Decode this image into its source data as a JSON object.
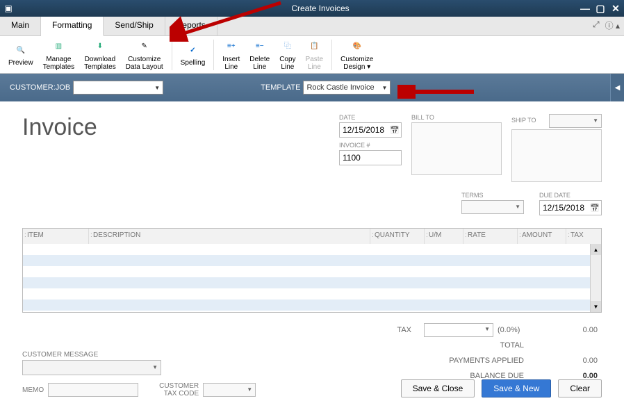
{
  "window": {
    "title": "Create Invoices"
  },
  "tabs": {
    "main": "Main",
    "formatting": "Formatting",
    "sendship": "Send/Ship",
    "reports": "Reports"
  },
  "ribbon": {
    "preview": "Preview",
    "manage_templates": "Manage\nTemplates",
    "download_templates": "Download\nTemplates",
    "customize_data_layout": "Customize\nData Layout",
    "spelling": "Spelling",
    "insert_line": "Insert\nLine",
    "delete_line": "Delete\nLine",
    "copy_line": "Copy\nLine",
    "paste_line": "Paste\nLine",
    "customize_design": "Customize\nDesign ▾"
  },
  "customer_bar": {
    "customer_job_label": "CUSTOMER:JOB",
    "customer_job_value": "",
    "template_label": "TEMPLATE",
    "template_value": "Rock Castle Invoice"
  },
  "invoice": {
    "title": "Invoice",
    "date_label": "DATE",
    "date_value": "12/15/2018",
    "invoice_num_label": "INVOICE #",
    "invoice_num_value": "1100",
    "bill_to_label": "BILL TO",
    "ship_to_label": "SHIP TO",
    "terms_label": "TERMS",
    "terms_value": "",
    "due_date_label": "DUE DATE",
    "due_date_value": "12/15/2018"
  },
  "columns": {
    "item": "ITEM",
    "description": "DESCRIPTION",
    "quantity": "QUANTITY",
    "um": "U/M",
    "rate": "RATE",
    "amount": "AMOUNT",
    "tax": "TAX"
  },
  "totals": {
    "tax_label": "TAX",
    "tax_pct": "(0.0%)",
    "tax_amount": "0.00",
    "total_label": "TOTAL",
    "payments_applied_label": "PAYMENTS APPLIED",
    "payments_applied_value": "0.00",
    "balance_due_label": "BALANCE DUE",
    "balance_due_value": "0.00"
  },
  "bottom": {
    "customer_message_label": "CUSTOMER MESSAGE",
    "memo_label": "MEMO",
    "customer_tax_code_label": "CUSTOMER\nTAX CODE"
  },
  "buttons": {
    "save_close": "Save & Close",
    "save_new": "Save & New",
    "clear": "Clear"
  }
}
